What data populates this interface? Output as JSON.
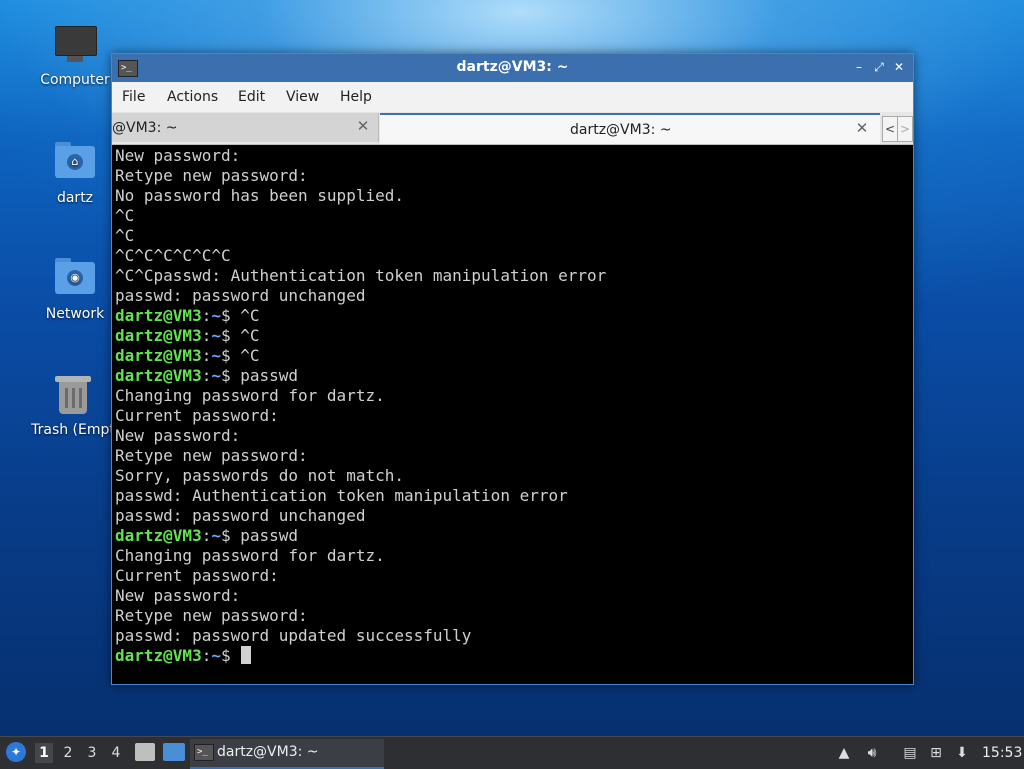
{
  "desktop": {
    "icons": [
      {
        "label": "Computer",
        "icon": "computer-icon"
      },
      {
        "label": "dartz",
        "icon": "home-folder-icon"
      },
      {
        "label": "Network",
        "icon": "network-folder-icon"
      },
      {
        "label": "Trash (Empt",
        "icon": "trash-icon"
      }
    ]
  },
  "window": {
    "title": "dartz@VM3: ~",
    "menu": [
      "File",
      "Actions",
      "Edit",
      "View",
      "Help"
    ],
    "tabs": [
      {
        "label": "@VM3: ~",
        "active": false
      },
      {
        "label": "dartz@VM3: ~",
        "active": true
      }
    ],
    "prompt_user": "dartz@VM3",
    "prompt_sep": ":",
    "prompt_path": "~",
    "prompt_symbol": "$",
    "lines": [
      {
        "text": "New password:"
      },
      {
        "text": "Retype new password:"
      },
      {
        "text": "No password has been supplied."
      },
      {
        "text": "^C"
      },
      {
        "text": "^C"
      },
      {
        "text": "^C^C^C^C^C^C"
      },
      {
        "text": "^C^Cpasswd: Authentication token manipulation error"
      },
      {
        "text": "passwd: password unchanged"
      },
      {
        "prompt": true,
        "cmd": " ^C"
      },
      {
        "prompt": true,
        "cmd": " ^C"
      },
      {
        "prompt": true,
        "cmd": " ^C"
      },
      {
        "prompt": true,
        "cmd": " passwd"
      },
      {
        "text": "Changing password for dartz."
      },
      {
        "text": "Current password:"
      },
      {
        "text": "New password:"
      },
      {
        "text": "Retype new password:"
      },
      {
        "text": "Sorry, passwords do not match."
      },
      {
        "text": "passwd: Authentication token manipulation error"
      },
      {
        "text": "passwd: password unchanged"
      },
      {
        "prompt": true,
        "cmd": " passwd"
      },
      {
        "text": "Changing password for dartz."
      },
      {
        "text": "Current password:"
      },
      {
        "text": "New password:"
      },
      {
        "text": "Retype new password:"
      },
      {
        "text": "passwd: password updated successfully"
      },
      {
        "prompt": true,
        "cmd": " ",
        "cursor": true
      }
    ]
  },
  "taskbar": {
    "workspaces": [
      "1",
      "2",
      "3",
      "4"
    ],
    "active_workspace": "1",
    "task_label": "dartz@VM3: ~",
    "clock": "15:53"
  },
  "colors": {
    "prompt_user": "#62e34f",
    "prompt_path": "#6aa3ff",
    "titlebar": "#3c6fae"
  }
}
